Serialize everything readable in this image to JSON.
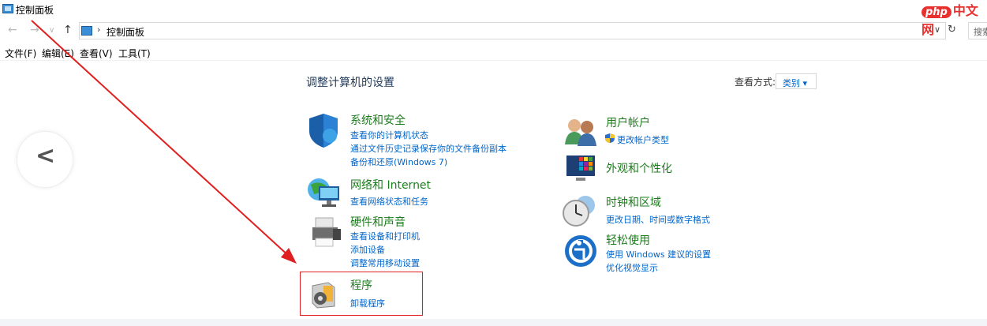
{
  "window": {
    "title": "控制面板"
  },
  "address_bar": {
    "crumb": "控制面板",
    "search_placeholder": "搜索"
  },
  "menu": [
    "文件(F)",
    "编辑(E)",
    "查看(V)",
    "工具(T)"
  ],
  "watermark": {
    "logo": "php",
    "text": "中文网"
  },
  "main": {
    "heading": "调整计算机的设置",
    "view_by_label": "查看方式:",
    "view_by_value": "类别 ▾"
  },
  "categories": [
    {
      "title": "系统和安全",
      "links": [
        "查看你的计算机状态",
        "通过文件历史记录保存你的文件备份副本",
        "备份和还原(Windows 7)"
      ]
    },
    {
      "title": "网络和 Internet",
      "links": [
        "查看网络状态和任务"
      ]
    },
    {
      "title": "硬件和声音",
      "links": [
        "查看设备和打印机",
        "添加设备",
        "调整常用移动设置"
      ]
    },
    {
      "title": "程序",
      "links": [
        "卸载程序"
      ]
    },
    {
      "title": "用户帐户",
      "links": [
        "更改帐户类型"
      ]
    },
    {
      "title": "外观和个性化",
      "links": []
    },
    {
      "title": "时钟和区域",
      "links": [
        "更改日期、时间或数字格式"
      ]
    },
    {
      "title": "轻松使用",
      "links": [
        "使用 Windows 建议的设置",
        "优化视觉显示"
      ]
    }
  ],
  "colors": {
    "category_title": "#1c7c1c",
    "link": "#0066cc",
    "annotation": "#e02020"
  }
}
